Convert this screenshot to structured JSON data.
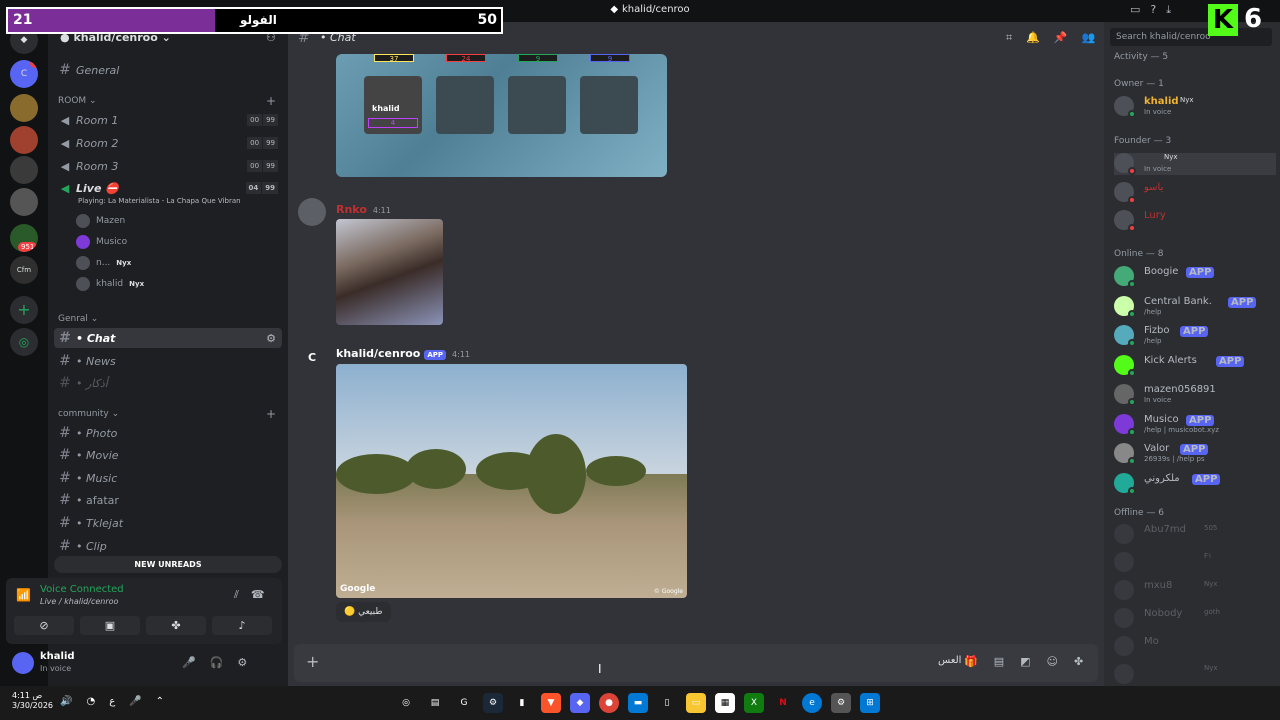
{
  "window": {
    "title": "khalid/cenroo"
  },
  "overlay": {
    "score_left": "21",
    "score_label": "الفولو",
    "score_right": "50",
    "score_fill": 0.42,
    "kick_count": "6",
    "kick_logo": "K"
  },
  "servers": [
    {
      "name": "home",
      "badge": ""
    },
    {
      "name": "cenroo",
      "badge": "4"
    },
    {
      "name": "server-2",
      "badge": ""
    },
    {
      "name": "server-3",
      "badge": ""
    },
    {
      "name": "server-4",
      "badge": ""
    },
    {
      "name": "server-5",
      "badge": ""
    },
    {
      "name": "server-6",
      "badge": "951"
    },
    {
      "name": "Cfm",
      "badge": ""
    }
  ],
  "sidebar": {
    "server_name": "khalid/cenroo",
    "general_channel": "General",
    "room_category": "ROOM",
    "rooms": [
      {
        "name": "Room 1",
        "a": "00",
        "b": "99"
      },
      {
        "name": "Room 2",
        "a": "00",
        "b": "99"
      },
      {
        "name": "Room 3",
        "a": "00",
        "b": "99"
      },
      {
        "name": "Live",
        "a": "04",
        "b": "99"
      }
    ],
    "live_status": "Playing: La Materialista - La Chapa Que Vibran",
    "voice_users": [
      {
        "name": "Mazen",
        "tag": ""
      },
      {
        "name": "Musico",
        "tag": ""
      },
      {
        "name": "n...",
        "tag": "Nyx"
      },
      {
        "name": "khalid",
        "tag": "Nyx"
      }
    ],
    "genral_category": "Genral",
    "genral_channels": [
      "• Chat",
      "• News",
      "• أذكار"
    ],
    "community_category": "community",
    "community_channels": [
      "• Photo",
      "• Movie",
      "• Music",
      "• afatar",
      "• Tklejat",
      "• Clip"
    ],
    "new_unreads": "NEW UNREADS"
  },
  "voice": {
    "title": "Voice Connected",
    "sub": "Live / khalid/cenroo"
  },
  "user": {
    "name": "khalid",
    "status": "In voice"
  },
  "chat": {
    "channel": "• Chat",
    "score_tiles": [
      "37",
      "24",
      "9",
      "9"
    ],
    "game_player": "khalid",
    "game_player_score": "4",
    "msg1": {
      "author": "Rnko",
      "time": "4:11 AM"
    },
    "msg2": {
      "author": "khalid/cenroo",
      "app": "APP",
      "time": "4:11 AM"
    },
    "google": "Google",
    "google_small": "© Google",
    "reaction": "طبيعي",
    "composer_text": "العس"
  },
  "members": {
    "activity_header": "Activity — 5",
    "owner_header": "Owner — 1",
    "owner": [
      {
        "name": "khalid",
        "tag": "Nyx",
        "status": "In voice",
        "color": "#f0b232"
      }
    ],
    "founder_header": "Founder — 3",
    "founders": [
      {
        "name": "",
        "tag": "Nyx",
        "status": "In voice",
        "color": "#c03030"
      },
      {
        "name": "ياسو",
        "tag": "",
        "status": "",
        "color": "#c03030"
      },
      {
        "name": "Lury",
        "tag": "",
        "status": "",
        "color": "#c03030"
      }
    ],
    "online_header": "Online — 8",
    "online": [
      {
        "name": "Boogie",
        "app": "APP",
        "status": ""
      },
      {
        "name": "Central Bank.",
        "app": "APP",
        "status": "/help"
      },
      {
        "name": "Fizbo",
        "app": "APP",
        "status": "/help"
      },
      {
        "name": "Kick Alerts",
        "app": "APP",
        "status": ""
      },
      {
        "name": "mazen056891",
        "app": "",
        "status": "In voice"
      },
      {
        "name": "Musico",
        "app": "APP",
        "status": "/help | musicobot.xyz"
      },
      {
        "name": "Valor",
        "app": "APP",
        "status": "26939s | /help ps"
      },
      {
        "name": "ملكروني",
        "app": "APP",
        "status": ""
      }
    ],
    "offline_header": "Offline — 6",
    "offline": [
      {
        "name": "Abu7md",
        "tag": "505"
      },
      {
        "name": "",
        "tag": "F١"
      },
      {
        "name": "mxu8",
        "tag": "Nyx"
      },
      {
        "name": "Nobody",
        "tag": "goth"
      },
      {
        "name": "Mo",
        "tag": ""
      },
      {
        "name": "",
        "tag": "Nyx"
      }
    ]
  },
  "taskbar": {
    "time": "4:11 ص",
    "date": "3/30/2026",
    "lang": "ع"
  },
  "search": {
    "placeholder": "Search khalid/cenroo"
  }
}
